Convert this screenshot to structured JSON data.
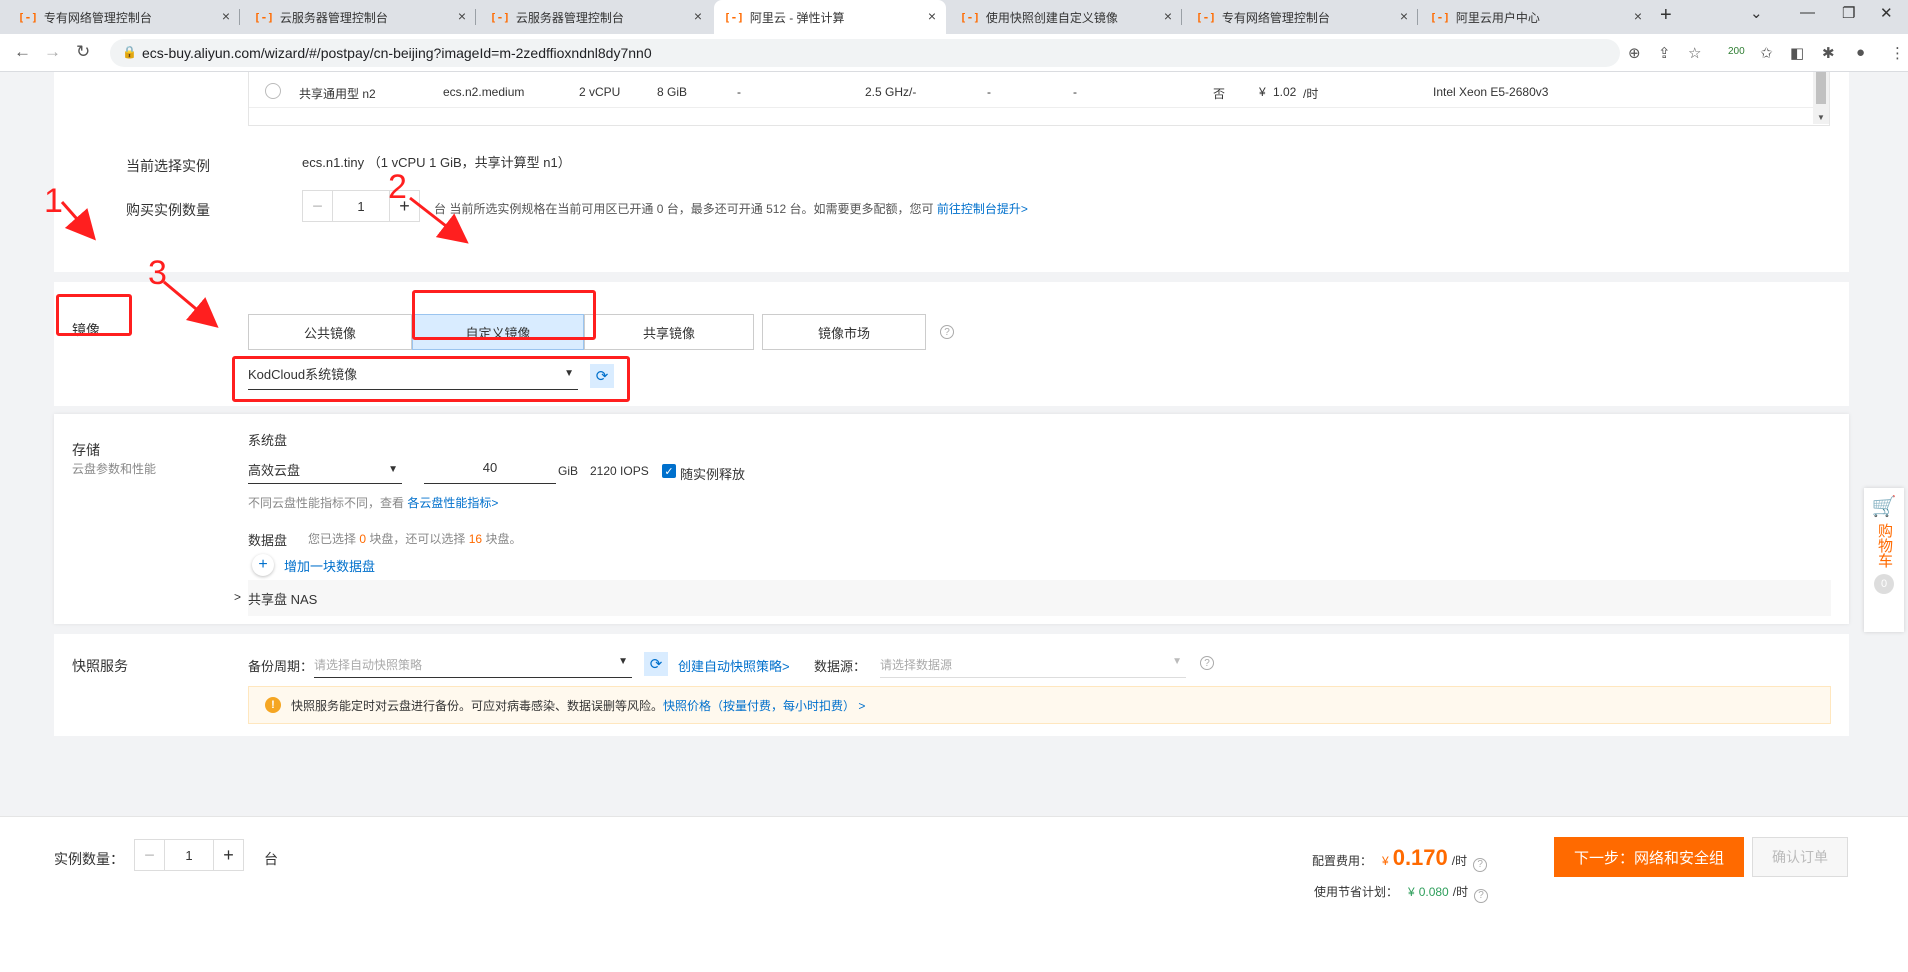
{
  "browser": {
    "tabs": [
      {
        "label": "专有网络管理控制台"
      },
      {
        "label": "云服务器管理控制台"
      },
      {
        "label": "云服务器管理控制台"
      },
      {
        "label": "阿里云 - 弹性计算"
      },
      {
        "label": "使用快照创建自定义镜像"
      },
      {
        "label": "专有网络管理控制台"
      },
      {
        "label": "阿里云用户中心"
      }
    ],
    "tab_icon": "[-]",
    "url": "ecs-buy.aliyun.com/wizard/#/postpay/cn-beijing?imageId=m-2zedffioxndnl8dy7nn0",
    "extension_badge": "200"
  },
  "instance_row": {
    "family": "共享通用型 n2",
    "spec": "ecs.n2.medium",
    "vcpu": "2 vCPU",
    "memory": "8 GiB",
    "gpu": "-",
    "clock": "2.5 GHz/-",
    "pps": "-",
    "bandwidth": "-",
    "ipv6": "否",
    "price_symbol": "¥",
    "price": "1.02",
    "price_unit": "/时",
    "cpu_model": "Intel Xeon E5-2680v3"
  },
  "selection": {
    "current_label": "当前选择实例",
    "current_value": "ecs.n1.tiny （1 vCPU 1 GiB，共享计算型 n1）",
    "quantity_label": "购买实例数量",
    "quantity": "1",
    "quantity_unit": "台",
    "quota_text_1": "当前所选实例规格在当前可用区已开通",
    "quota_opened": "0",
    "quota_text_2": "台，最多还可开通",
    "quota_max": "512",
    "quota_text_3": "台。如需要更多配额，您可",
    "quota_link": "前往控制台提升>"
  },
  "image": {
    "label": "镜像",
    "tabs": [
      "公共镜像",
      "自定义镜像",
      "共享镜像",
      "镜像市场"
    ],
    "selected_tab": "自定义镜像",
    "selected_image": "KodCloud系统镜像",
    "help": "?"
  },
  "annotations": [
    "1",
    "2",
    "3"
  ],
  "storage": {
    "label": "存储",
    "sublabel": "云盘参数和性能",
    "system_disk_label": "系统盘",
    "disk_type": "高效云盘",
    "disk_size": "40",
    "disk_unit": "GiB",
    "iops": "2120 IOPS",
    "release_label": "随实例释放",
    "release_checked": true,
    "perf_text": "不同云盘性能指标不同，查看",
    "perf_link": "各云盘性能指标>",
    "data_disk_label": "数据盘",
    "data_disk_text_1": "您已选择",
    "data_disk_selected": "0",
    "data_disk_text_2": "块盘，还可以选择",
    "data_disk_remaining": "16",
    "data_disk_text_3": "块盘。",
    "add_disk_label": "增加一块数据盘",
    "nas_label": "共享盘 NAS"
  },
  "snapshot": {
    "label": "快照服务",
    "cycle_label": "备份周期：",
    "cycle_placeholder": "请选择自动快照策略",
    "create_link": "创建自动快照策略>",
    "source_label": "数据源：",
    "source_placeholder": "请选择数据源",
    "notice_text": "快照服务能定时对云盘进行备份。可应对病毒感染、数据误删等风险。",
    "notice_link": "快照价格（按量付费，每小时扣费） >"
  },
  "cart": {
    "label": "购物车",
    "count": "0"
  },
  "footer": {
    "quantity_label": "实例数量：",
    "quantity": "1",
    "quantity_unit": "台",
    "config_fee_label": "配置费用：",
    "currency": "¥",
    "config_fee": "0.170",
    "fee_unit": "/时",
    "saving_plan_label": "使用节省计划：",
    "saving_plan_fee": "0.080",
    "next_button": "下一步：网络和安全组",
    "confirm_button": "确认订单"
  },
  "colors": {
    "accent_orange": "#ff6a00",
    "link_blue": "#0070cc",
    "annotation_red": "#ff1f1f",
    "selected_tab_bg": "#d9ecff"
  }
}
